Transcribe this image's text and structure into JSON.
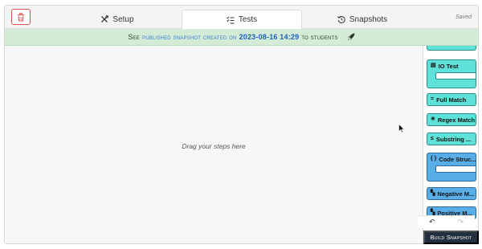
{
  "tabs": {
    "setup": "Setup",
    "tests": "Tests",
    "snapshots": "Snapshots",
    "saved": "Saved"
  },
  "banner": {
    "see": "See",
    "link": "published snapshot created on",
    "date": "2023-08-16 14:29",
    "to": "to students"
  },
  "canvas": {
    "placeholder": "Drag your steps here"
  },
  "palette": {
    "blocks": [
      {
        "label": "IO Test",
        "glyph": "▤"
      },
      {
        "label": "Full Match",
        "glyph": "="
      },
      {
        "label": "Regex Match",
        "glyph": "✳"
      },
      {
        "label": "Substring ...",
        "glyph": "≤"
      },
      {
        "label": "Code Struc...",
        "glyph": "{ }"
      },
      {
        "label": "Negative M...",
        "glyph": "▚"
      },
      {
        "label": "Positive M...",
        "glyph": "▚"
      }
    ]
  },
  "actions": {
    "undo": "↶",
    "redo": "↷",
    "build": "Build Snapshot"
  },
  "colors": {
    "banner_bg": "#d4ecd6",
    "teal_block": "#5fe0d8",
    "blue_block": "#5aaee8",
    "build_button": "#23303f",
    "danger": "#d9534f"
  }
}
